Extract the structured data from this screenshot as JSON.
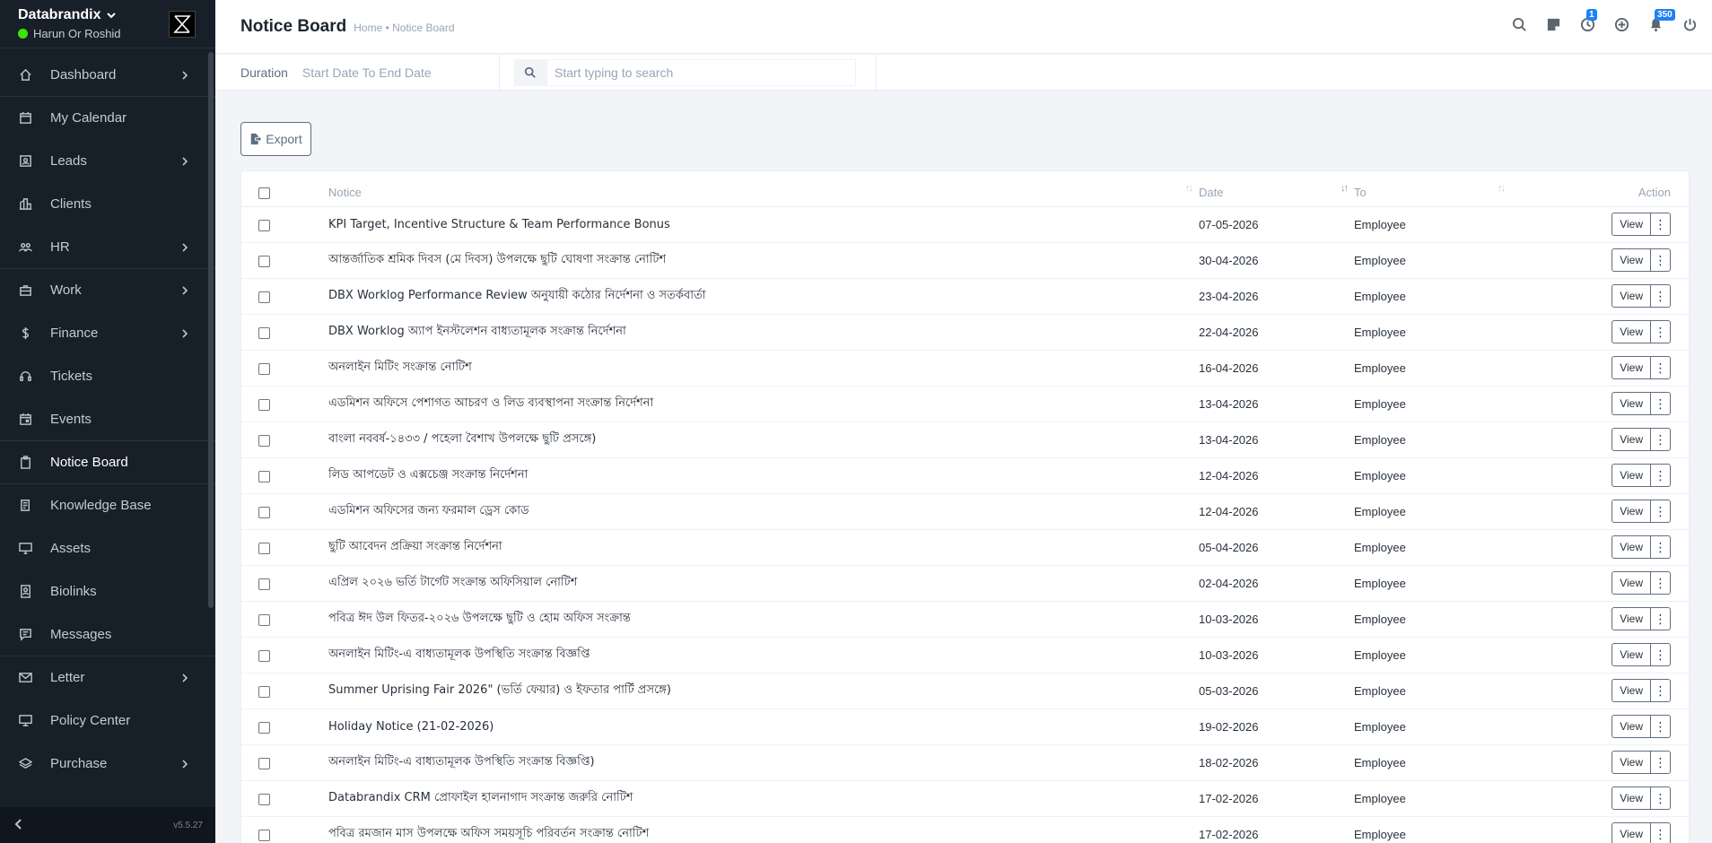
{
  "app": {
    "brand": "Databrandix",
    "user": "Harun Or Roshid",
    "version": "v5.5.27"
  },
  "sidebar": {
    "items": [
      {
        "label": "Dashboard",
        "icon": "home-icon",
        "has_children": true
      },
      {
        "label": "My Calendar",
        "icon": "calendar-icon",
        "has_children": false
      },
      {
        "label": "Leads",
        "icon": "leads-icon",
        "has_children": true
      },
      {
        "label": "Clients",
        "icon": "building-icon",
        "has_children": false
      },
      {
        "label": "HR",
        "icon": "people-icon",
        "has_children": true
      },
      {
        "label": "Work",
        "icon": "briefcase-icon",
        "has_children": true
      },
      {
        "label": "Finance",
        "icon": "dollar-icon",
        "has_children": true
      },
      {
        "label": "Tickets",
        "icon": "headset-icon",
        "has_children": false
      },
      {
        "label": "Events",
        "icon": "calendar-event-icon",
        "has_children": false
      },
      {
        "label": "Notice Board",
        "icon": "clipboard-icon",
        "has_children": false,
        "active": true
      },
      {
        "label": "Knowledge Base",
        "icon": "book-icon",
        "has_children": false
      },
      {
        "label": "Assets",
        "icon": "monitor-icon",
        "has_children": false
      },
      {
        "label": "Biolinks",
        "icon": "id-card-icon",
        "has_children": false
      },
      {
        "label": "Messages",
        "icon": "message-icon",
        "has_children": false
      },
      {
        "label": "Letter",
        "icon": "envelope-icon",
        "has_children": true
      },
      {
        "label": "Policy Center",
        "icon": "display-icon",
        "has_children": false
      },
      {
        "label": "Purchase",
        "icon": "layers-icon",
        "has_children": true
      }
    ]
  },
  "header": {
    "title": "Notice Board",
    "breadcrumb": "Home • Notice Board",
    "badges": {
      "clock": "1",
      "notifications": "350"
    }
  },
  "filters": {
    "duration_label": "Duration",
    "duration_value": "Start Date To End Date",
    "search_placeholder": "Start typing to search"
  },
  "export_label": "Export",
  "table": {
    "headers": {
      "notice": "Notice",
      "date": "Date",
      "to": "To",
      "action": "Action"
    },
    "view_label": "View",
    "rows": [
      {
        "notice": "KPI Target, Incentive Structure & Team Performance Bonus",
        "date": "07-05-2026",
        "to": "Employee"
      },
      {
        "notice": "আন্তর্জাতিক শ্রমিক দিবস (মে দিবস) উপলক্ষে ছুটি ঘোষণা সংক্রান্ত নোটিশ",
        "date": "30-04-2026",
        "to": "Employee"
      },
      {
        "notice": "DBX Worklog Performance Review অনুযায়ী কঠোর নির্দেশনা ও সতর্কবার্তা",
        "date": "23-04-2026",
        "to": "Employee"
      },
      {
        "notice": "DBX Worklog অ্যাপ ইনস্টলেশন বাধ্যতামূলক সংক্রান্ত নির্দেশনা",
        "date": "22-04-2026",
        "to": "Employee"
      },
      {
        "notice": "অনলাইন মিটিং সংক্রান্ত নোটিশ",
        "date": "16-04-2026",
        "to": "Employee"
      },
      {
        "notice": "এডমিশন অফিসে পেশাগত আচরণ ও লিড ব্যবস্থাপনা সংক্রান্ত নির্দেশনা",
        "date": "13-04-2026",
        "to": "Employee"
      },
      {
        "notice": "বাংলা নববর্ষ-১৪৩৩ / পহেলা বৈশাখ উপলক্ষে ছুটি প্রসঙ্গে)",
        "date": "13-04-2026",
        "to": "Employee"
      },
      {
        "notice": "লিড আপডেট ও এক্সচেঞ্জ সংক্রান্ত নির্দেশনা",
        "date": "12-04-2026",
        "to": "Employee"
      },
      {
        "notice": "এডমিশন অফিসের জন্য ফরমাল ড্রেস কোড",
        "date": "12-04-2026",
        "to": "Employee"
      },
      {
        "notice": "ছুটি আবেদন প্রক্রিয়া সংক্রান্ত নির্দেশনা",
        "date": "05-04-2026",
        "to": "Employee"
      },
      {
        "notice": "এপ্রিল ২০২৬ ভর্তি টার্গেট সংক্রান্ত অফিসিয়াল নোটিশ",
        "date": "02-04-2026",
        "to": "Employee"
      },
      {
        "notice": "পবিত্র ঈদ উল ফিতর-২০২৬ উপলক্ষে ছুটি ও হোম অফিস সংক্রান্ত",
        "date": "10-03-2026",
        "to": "Employee"
      },
      {
        "notice": "অনলাইন মিটিং-এ বাধ্যতামূলক উপস্থিতি সংক্রান্ত বিজ্ঞপ্তি",
        "date": "10-03-2026",
        "to": "Employee"
      },
      {
        "notice": "Summer Uprising Fair 2026\" (ভর্তি ফেয়ার) ও ইফতার পার্টি প্রসঙ্গে)",
        "date": "05-03-2026",
        "to": "Employee"
      },
      {
        "notice": "Holiday Notice (21-02-2026)",
        "date": "19-02-2026",
        "to": "Employee"
      },
      {
        "notice": "অনলাইন মিটিং-এ বাধ্যতামূলক উপস্থিতি সংক্রান্ত বিজ্ঞপ্তি)",
        "date": "18-02-2026",
        "to": "Employee"
      },
      {
        "notice": "Databrandix CRM প্রোফাইল হালনাগাদ সংক্রান্ত জরুরি নোটিশ",
        "date": "17-02-2026",
        "to": "Employee"
      },
      {
        "notice": "পবিত্র রমজান মাস উপলক্ষে অফিস সময়সূচি পরিবর্তন সংক্রান্ত নোটিশ",
        "date": "17-02-2026",
        "to": "Employee"
      }
    ]
  }
}
